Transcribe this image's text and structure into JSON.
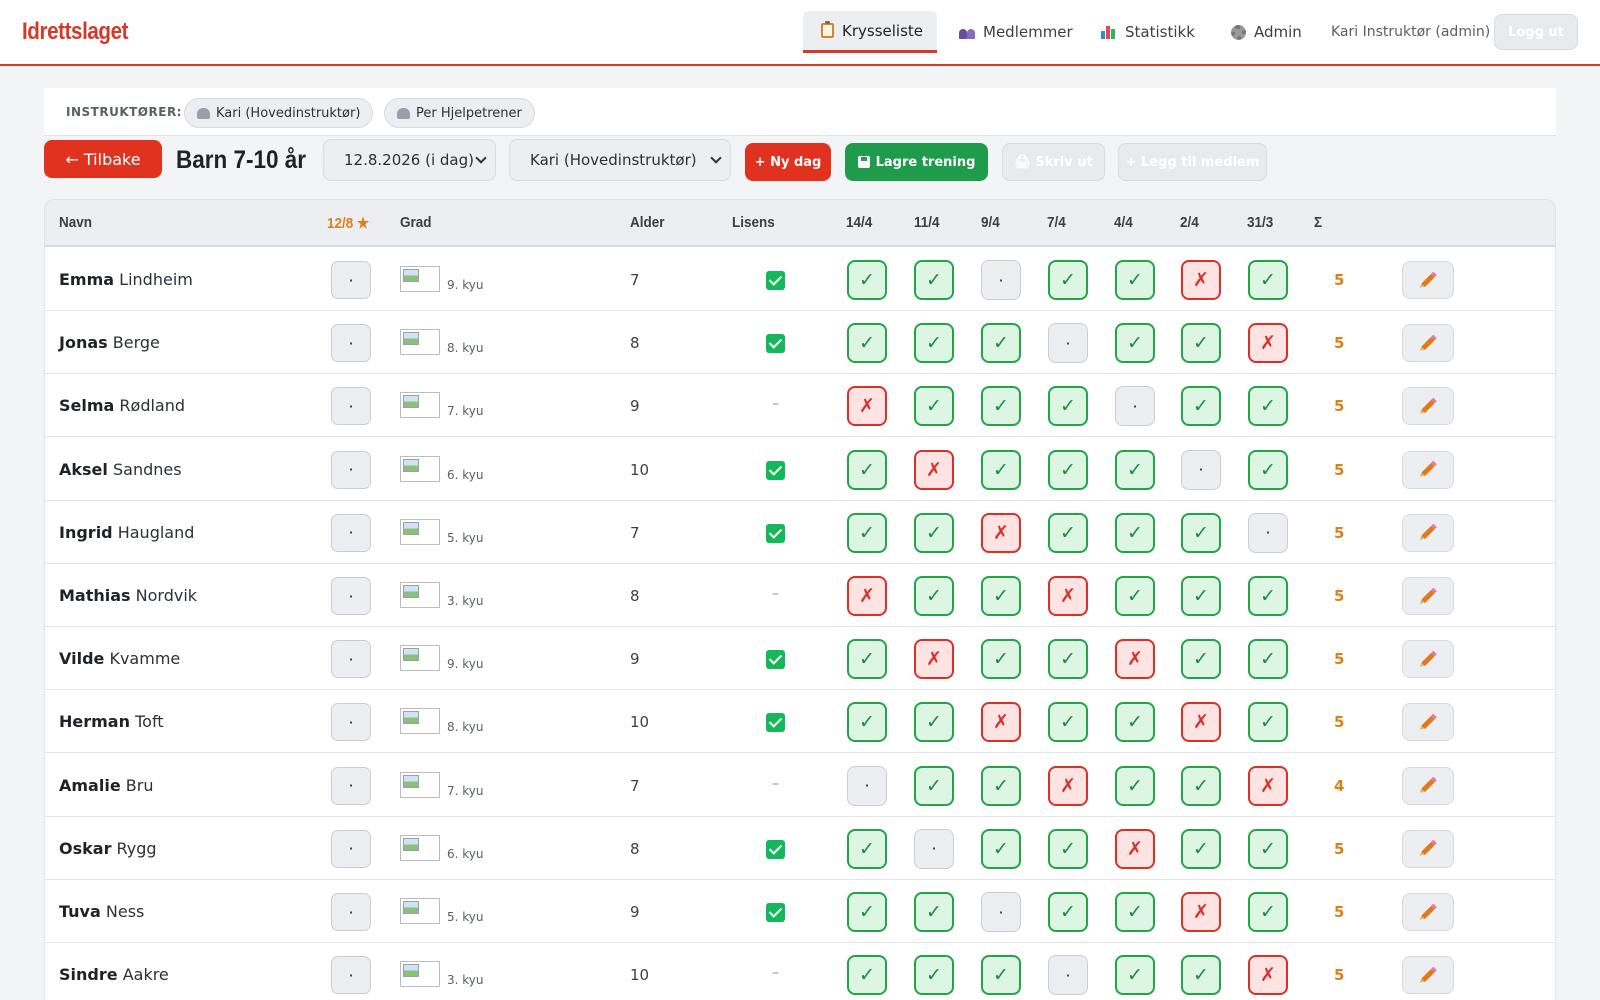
{
  "app": {
    "logo": "Idrettslaget",
    "nav": [
      {
        "label": "Krysseliste",
        "icon": "clipboard-icon",
        "active": true
      },
      {
        "label": "Medlemmer",
        "icon": "people-icon",
        "active": false
      },
      {
        "label": "Statistikk",
        "icon": "bar-chart-icon",
        "active": false
      },
      {
        "label": "Admin",
        "icon": "gear-icon",
        "active": false
      }
    ],
    "user": "Kari Instruktør (admin)",
    "logout": "Logg ut"
  },
  "instructors": {
    "label": "INSTRUKTØRER:",
    "chips": [
      "Kari (Hovedinstruktør)",
      "Per Hjelpetrener"
    ]
  },
  "toolbar": {
    "back": "← Tilbake",
    "group": "Barn 7-10 år",
    "date_select": "12.8.2026 (i dag)",
    "instructor_select": "Kari (Hovedinstruktør)",
    "new_day": "+ Ny dag",
    "save": "Lagre trening",
    "print": "🖨 Skriv ut",
    "add_member": "+ Legg til medlem"
  },
  "table": {
    "headers": {
      "name": "Navn",
      "today": "12/8 ★",
      "grade": "Grad",
      "age": "Alder",
      "license": "Lisens",
      "dates": [
        "14/4",
        "11/4",
        "9/4",
        "7/4",
        "4/4",
        "2/4",
        "31/3"
      ],
      "sum": "Σ"
    },
    "symbols": {
      "yes": "✓",
      "no": "✗",
      "none": "·"
    },
    "today_mark": "·",
    "license_none": "–",
    "colors": {
      "accent": "#d33a2c",
      "present": "#22a447",
      "absent": "#d9302a",
      "sum": "#d9811a"
    },
    "rows": [
      {
        "first": "Emma",
        "last": "Lindheim",
        "grade": "9. kyu",
        "age": "7",
        "license": true,
        "att": [
          "y",
          "y",
          "n0",
          "y",
          "y",
          "x",
          "y"
        ],
        "sum": "5"
      },
      {
        "first": "Jonas",
        "last": "Berge",
        "grade": "8. kyu",
        "age": "8",
        "license": true,
        "att": [
          "y",
          "y",
          "y",
          "n0",
          "y",
          "y",
          "x"
        ],
        "sum": "5"
      },
      {
        "first": "Selma",
        "last": "Rødland",
        "grade": "7. kyu",
        "age": "9",
        "license": false,
        "att": [
          "x",
          "y",
          "y",
          "y",
          "n0",
          "y",
          "y"
        ],
        "sum": "5"
      },
      {
        "first": "Aksel",
        "last": "Sandnes",
        "grade": "6. kyu",
        "age": "10",
        "license": true,
        "att": [
          "y",
          "x",
          "y",
          "y",
          "y",
          "n0",
          "y"
        ],
        "sum": "5"
      },
      {
        "first": "Ingrid",
        "last": "Haugland",
        "grade": "5. kyu",
        "age": "7",
        "license": true,
        "att": [
          "y",
          "y",
          "x",
          "y",
          "y",
          "y",
          "n0"
        ],
        "sum": "5"
      },
      {
        "first": "Mathias",
        "last": "Nordvik",
        "grade": "3. kyu",
        "age": "8",
        "license": false,
        "att": [
          "x",
          "y",
          "y",
          "x",
          "y",
          "y",
          "y"
        ],
        "sum": "5"
      },
      {
        "first": "Vilde",
        "last": "Kvamme",
        "grade": "9. kyu",
        "age": "9",
        "license": true,
        "att": [
          "y",
          "x",
          "y",
          "y",
          "x",
          "y",
          "y"
        ],
        "sum": "5"
      },
      {
        "first": "Herman",
        "last": "Toft",
        "grade": "8. kyu",
        "age": "10",
        "license": true,
        "att": [
          "y",
          "y",
          "x",
          "y",
          "y",
          "x",
          "y"
        ],
        "sum": "5"
      },
      {
        "first": "Amalie",
        "last": "Bru",
        "grade": "7. kyu",
        "age": "7",
        "license": false,
        "att": [
          "n0",
          "y",
          "y",
          "x",
          "y",
          "y",
          "x"
        ],
        "sum": "4"
      },
      {
        "first": "Oskar",
        "last": "Rygg",
        "grade": "6. kyu",
        "age": "8",
        "license": true,
        "att": [
          "y",
          "n0",
          "y",
          "y",
          "x",
          "y",
          "y"
        ],
        "sum": "5"
      },
      {
        "first": "Tuva",
        "last": "Ness",
        "grade": "5. kyu",
        "age": "9",
        "license": true,
        "att": [
          "y",
          "y",
          "n0",
          "y",
          "y",
          "x",
          "y"
        ],
        "sum": "5"
      },
      {
        "first": "Sindre",
        "last": "Aakre",
        "grade": "3. kyu",
        "age": "10",
        "license": false,
        "att": [
          "y",
          "y",
          "y",
          "n0",
          "y",
          "y",
          "x"
        ],
        "sum": "5"
      }
    ]
  }
}
